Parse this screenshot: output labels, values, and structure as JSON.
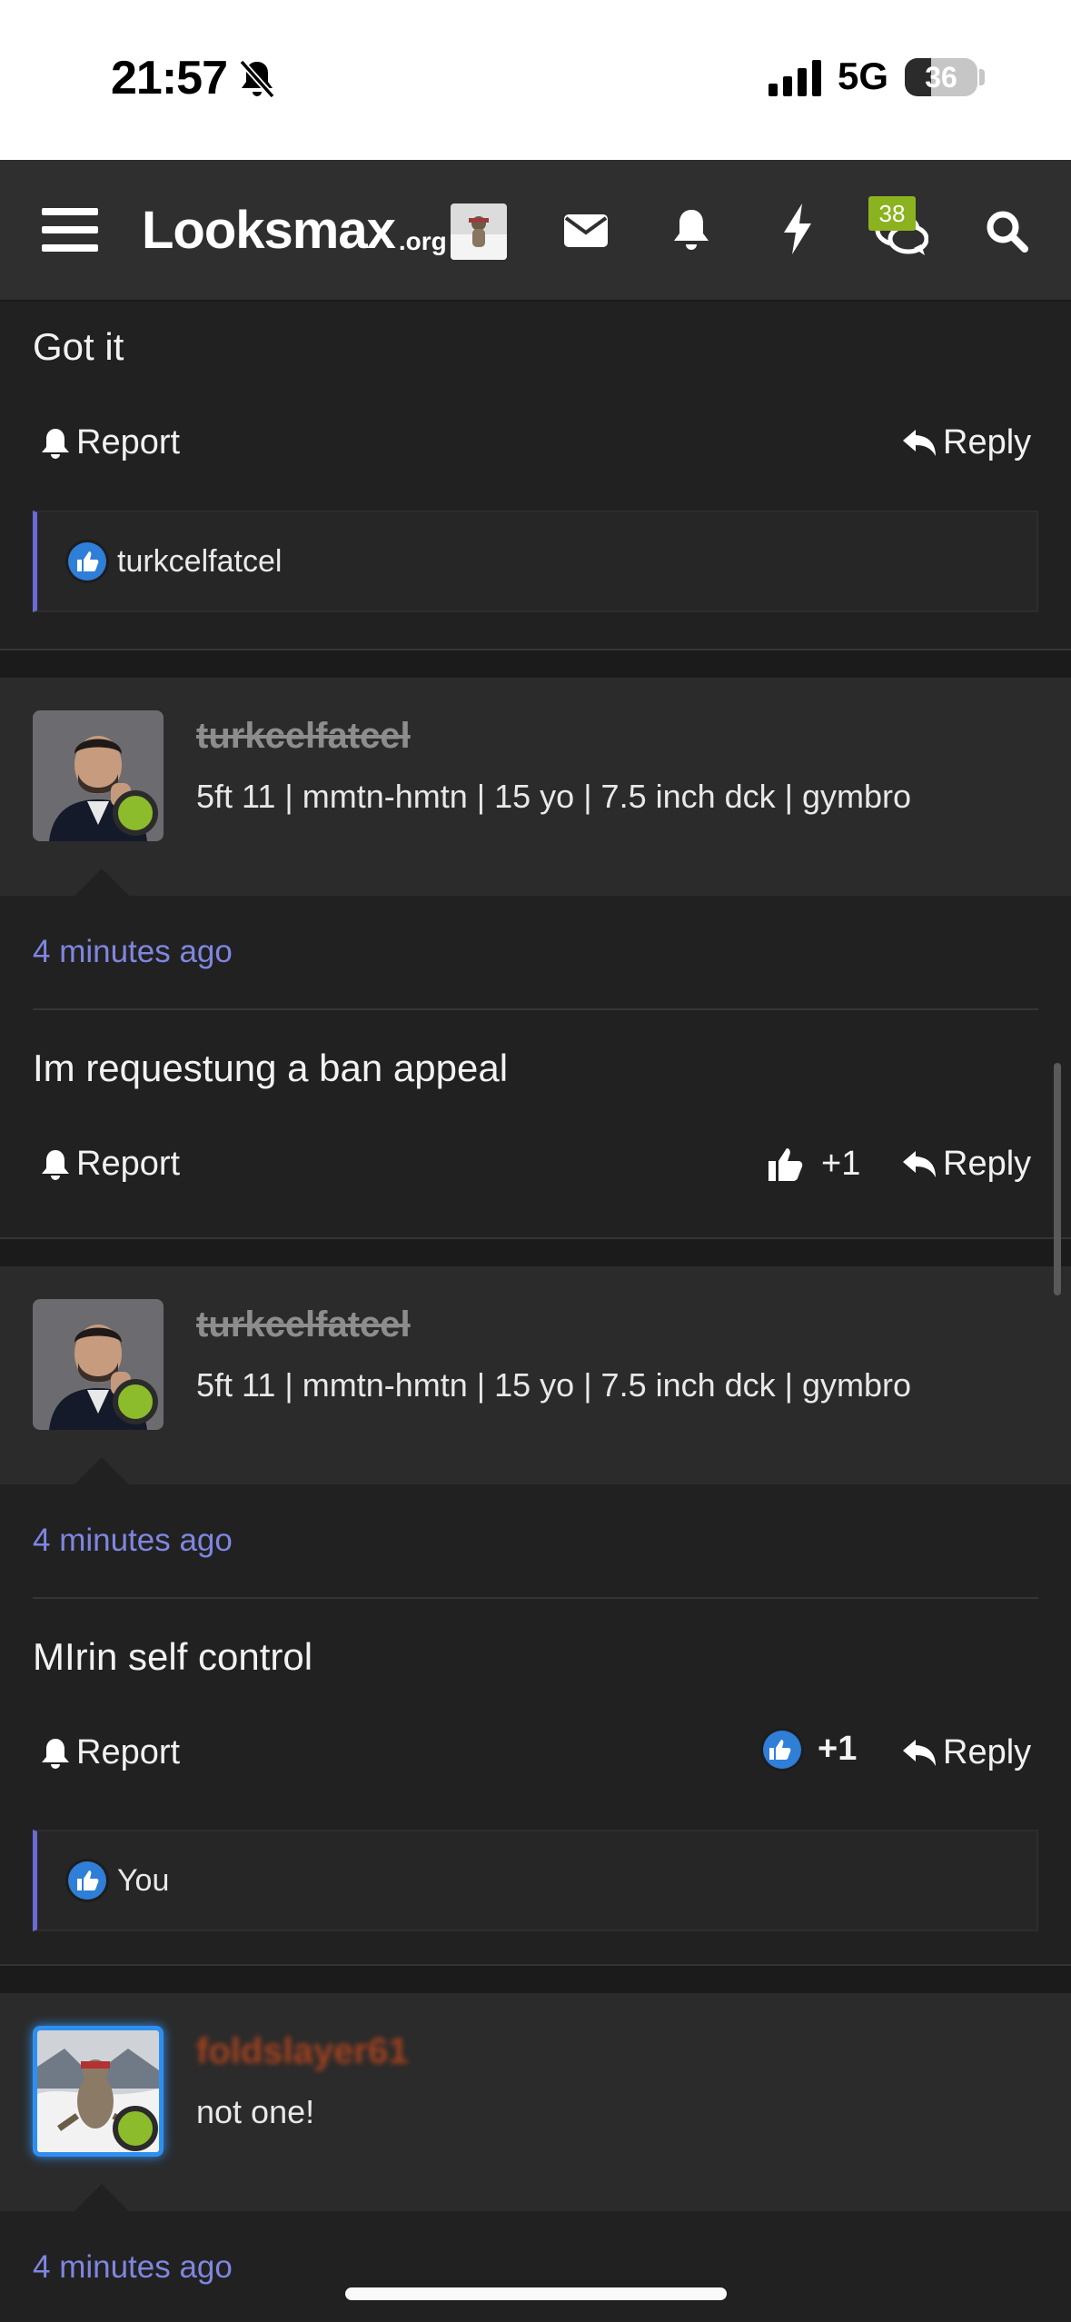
{
  "status_bar": {
    "time": "21:57",
    "network": "5G",
    "battery": "36",
    "battery_level": 0.36
  },
  "nav": {
    "logo_main": "Looksmax",
    "logo_suffix": ".org",
    "notification_badge": "38"
  },
  "posts": [
    {
      "body": "Got it",
      "report_label": "Report",
      "reply_label": "Reply",
      "liked_by": "turkcelfatcel"
    },
    {
      "username": "turkcelfatcel",
      "user_title": "5ft 11 | mmtn-hmtn | 15 yo | 7.5 inch dck | gymbro",
      "timestamp": "4 minutes ago",
      "body": "Im requestung a ban appeal",
      "report_label": "Report",
      "reaction_count": "+1",
      "reply_label": "Reply"
    },
    {
      "username": "turkcelfatcel",
      "user_title": "5ft 11 | mmtn-hmtn | 15 yo | 7.5 inch dck | gymbro",
      "timestamp": "4 minutes ago",
      "body": "MIrin self control",
      "report_label": "Report",
      "reaction_count": "+1",
      "reply_label": "Reply",
      "liked_by": "You"
    },
    {
      "username": "foldslayer61",
      "user_title": "not one!",
      "timestamp": "4 minutes ago"
    }
  ],
  "colors": {
    "accent": "#7f86e0",
    "online": "#8cbb2c",
    "like": "#2f7ed8",
    "badge": "#8ab31f"
  }
}
